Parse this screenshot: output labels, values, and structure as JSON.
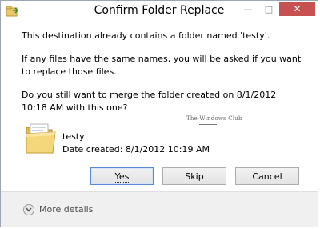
{
  "window": {
    "title": "Confirm Folder Replace",
    "controls": {
      "minimize": "—",
      "maximize": "□",
      "close": "✕"
    }
  },
  "message": {
    "line1": "This destination already contains a folder named 'testy'.",
    "line2": "If any files have the same names, you will be asked if you want to replace those files.",
    "line3": "Do you still want to merge the folder created on 8/1/2012 10:18 AM with this one?"
  },
  "folder": {
    "name": "testy",
    "date_created": "Date created: 8/1/2012 10:19 AM",
    "icon": "folder-icon"
  },
  "watermark": "The Windows Club",
  "buttons": {
    "yes": "Yes",
    "skip": "Skip",
    "cancel": "Cancel"
  },
  "footer": {
    "more_details": "More details",
    "icon": "chevron-down-circle-icon"
  },
  "colors": {
    "close_button": "#c75050",
    "default_button_border": "#5a8ad6",
    "footer_background": "#f0f0f0"
  }
}
